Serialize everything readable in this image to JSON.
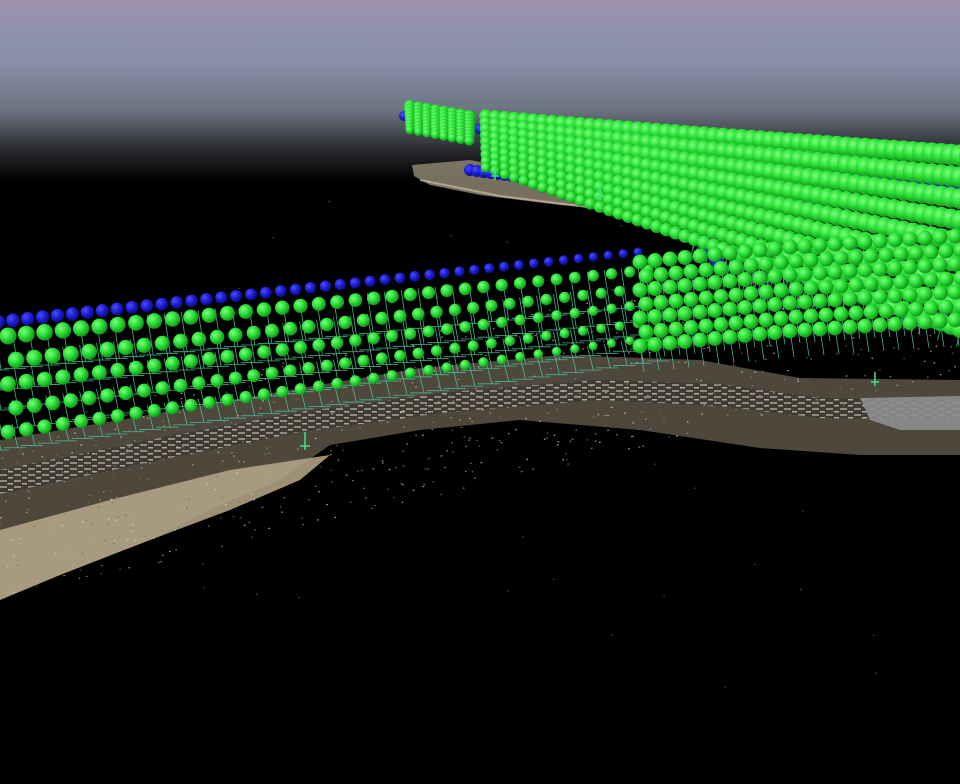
{
  "viewer": {
    "background": {
      "sky_top": "#8f8fae",
      "sky_mid": "#6f7585",
      "ground": "#000000"
    },
    "colors": {
      "camera_sphere_green": "#2fe33a",
      "camera_sphere_green_dark": "#0f8f18",
      "camera_sphere_blue": "#1d1fd6",
      "frustum_lines": "#4fc59a",
      "terrain_light": "#b9a98a",
      "terrain_dark": "#4d4a42",
      "terrain_gray": "#8e8e8e"
    },
    "layers": [
      {
        "name": "point-cloud",
        "icon": "point-cloud-icon"
      },
      {
        "name": "camera-frustums",
        "icon": "camera-icon"
      },
      {
        "name": "camera-centers",
        "icon": "sphere-icon"
      }
    ]
  }
}
